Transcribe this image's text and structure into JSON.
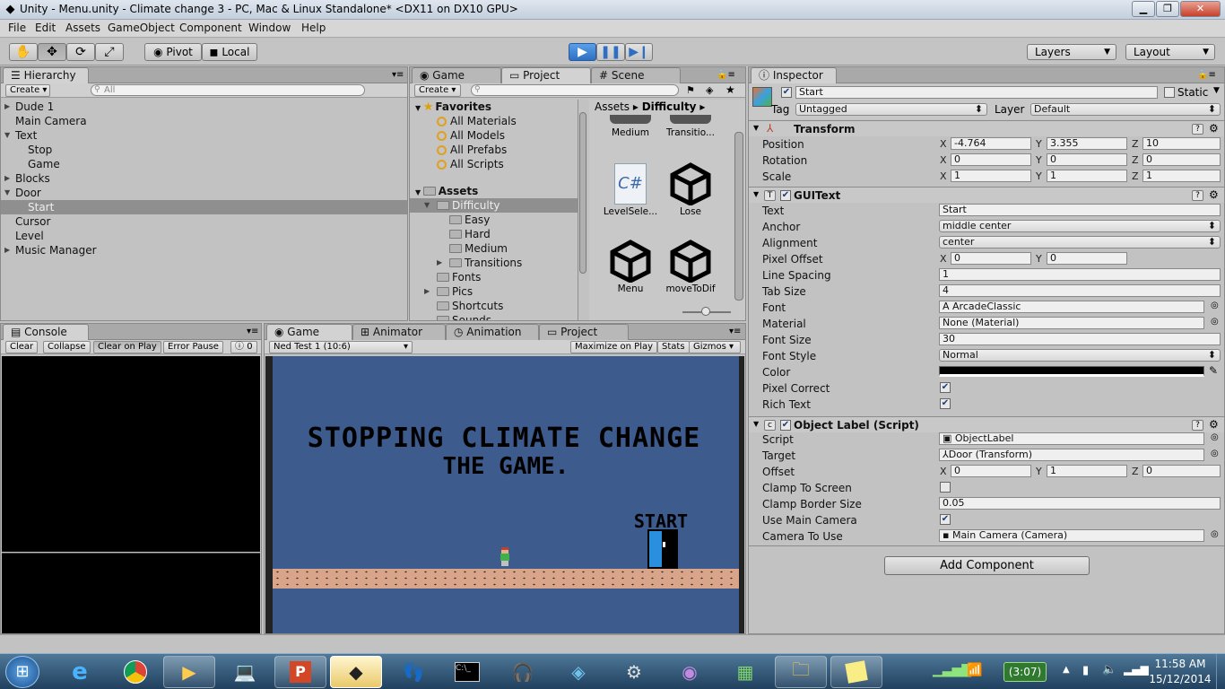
{
  "window": {
    "title": "Unity - Menu.unity - Climate change 3 - PC, Mac & Linux Standalone* <DX11 on DX10 GPU>",
    "minimize": "▁",
    "maximize": "❐",
    "close": "✕"
  },
  "menu": [
    "File",
    "Edit",
    "Assets",
    "GameObject",
    "Component",
    "Window",
    "Help"
  ],
  "toolbar": {
    "pivot_label": "Pivot",
    "local_label": "Local",
    "layers_label": "Layers",
    "layout_label": "Layout"
  },
  "hierarchy": {
    "tab": "Hierarchy",
    "create": "Create",
    "search_placeholder": "All",
    "items": [
      {
        "label": "Dude 1",
        "indent": 0,
        "arrow": "▶"
      },
      {
        "label": "Main Camera",
        "indent": 0,
        "arrow": ""
      },
      {
        "label": "Text",
        "indent": 0,
        "arrow": "▼"
      },
      {
        "label": "Stop",
        "indent": 1,
        "arrow": ""
      },
      {
        "label": "Game",
        "indent": 1,
        "arrow": ""
      },
      {
        "label": "Blocks",
        "indent": 0,
        "arrow": "▶"
      },
      {
        "label": "Door",
        "indent": 0,
        "arrow": "▼"
      },
      {
        "label": "Start",
        "indent": 1,
        "arrow": "",
        "selected": true
      },
      {
        "label": "Cursor",
        "indent": 0,
        "arrow": ""
      },
      {
        "label": "Level",
        "indent": 0,
        "arrow": ""
      },
      {
        "label": "Music Manager",
        "indent": 0,
        "arrow": "▶"
      }
    ]
  },
  "project": {
    "tabs": [
      "Game",
      "Project",
      "Scene"
    ],
    "create": "Create",
    "favorites_label": "Favorites",
    "favorites": [
      "All Materials",
      "All Models",
      "All Prefabs",
      "All Scripts"
    ],
    "assets_label": "Assets",
    "tree": [
      {
        "label": "Difficulty",
        "level": 1,
        "arrow": "▼",
        "selected": true
      },
      {
        "label": "Easy",
        "level": 2,
        "arrow": ""
      },
      {
        "label": "Hard",
        "level": 2,
        "arrow": ""
      },
      {
        "label": "Medium",
        "level": 2,
        "arrow": ""
      },
      {
        "label": "Transitions",
        "level": 2,
        "arrow": "▶"
      },
      {
        "label": "Fonts",
        "level": 1,
        "arrow": ""
      },
      {
        "label": "Pics",
        "level": 1,
        "arrow": "▶"
      },
      {
        "label": "Shortcuts",
        "level": 1,
        "arrow": ""
      },
      {
        "label": "Sounds",
        "level": 1,
        "arrow": ""
      }
    ],
    "breadcrumb": [
      "Assets",
      "Difficulty"
    ],
    "grid": [
      {
        "label": "Medium",
        "kind": "folder-partial"
      },
      {
        "label": "Transitio...",
        "kind": "folder-partial"
      },
      {
        "label": "LevelSele...",
        "kind": "cs"
      },
      {
        "label": "Lose",
        "kind": "unity"
      },
      {
        "label": "Menu",
        "kind": "unity"
      },
      {
        "label": "moveToDif",
        "kind": "unity"
      }
    ]
  },
  "console": {
    "tab": "Console",
    "buttons": [
      "Clear",
      "Collapse",
      "Clear on Play",
      "Error Pause"
    ],
    "count": "0"
  },
  "game": {
    "tabs": [
      "Game",
      "Animator",
      "Animation",
      "Project"
    ],
    "aspect": "Ned Test 1 (10:6)",
    "buttons": [
      "Maximize on Play",
      "Stats",
      "Gizmos"
    ],
    "title_line1": "STOPPING CLIMATE CHANGE",
    "title_line2": "THE GAME.",
    "start_label": "START"
  },
  "inspector": {
    "tab": "Inspector",
    "object_name": "Start",
    "static_label": "Static",
    "tag_label": "Tag",
    "tag_value": "Untagged",
    "layer_label": "Layer",
    "layer_value": "Default",
    "transform": {
      "title": "Transform",
      "rows": [
        {
          "label": "Position",
          "x": "-4.764",
          "y": "3.355",
          "z": "10"
        },
        {
          "label": "Rotation",
          "x": "0",
          "y": "0",
          "z": "0"
        },
        {
          "label": "Scale",
          "x": "1",
          "y": "1",
          "z": "1"
        }
      ]
    },
    "guitext": {
      "title": "GUIText",
      "text_label": "Text",
      "text_value": "Start",
      "anchor_label": "Anchor",
      "anchor_value": "middle center",
      "alignment_label": "Alignment",
      "alignment_value": "center",
      "pixel_offset_label": "Pixel Offset",
      "pixel_offset_x": "0",
      "pixel_offset_y": "0",
      "line_spacing_label": "Line Spacing",
      "line_spacing_value": "1",
      "tab_size_label": "Tab Size",
      "tab_size_value": "4",
      "font_label": "Font",
      "font_value": "ArcadeClassic",
      "material_label": "Material",
      "material_value": "None (Material)",
      "font_size_label": "Font Size",
      "font_size_value": "30",
      "font_style_label": "Font Style",
      "font_style_value": "Normal",
      "color_label": "Color",
      "color_value": "#000000",
      "pixel_correct_label": "Pixel Correct",
      "pixel_correct": true,
      "rich_text_label": "Rich Text",
      "rich_text": true
    },
    "object_label": {
      "title": "Object Label (Script)",
      "script_label": "Script",
      "script_value": "ObjectLabel",
      "target_label": "Target",
      "target_value": "Door (Transform)",
      "offset_label": "Offset",
      "offset_x": "0",
      "offset_y": "1",
      "offset_z": "0",
      "clamp_label": "Clamp To Screen",
      "clamp": false,
      "clamp_border_label": "Clamp Border Size",
      "clamp_border_value": "0.05",
      "use_main_label": "Use Main Camera",
      "use_main": true,
      "camera_label": "Camera To Use",
      "camera_value": "Main Camera (Camera)"
    },
    "add_component": "Add Component"
  },
  "taskbar": {
    "clock_time": "11:58 AM",
    "clock_date": "15/12/2014",
    "battery": "(3:07)"
  },
  "colors": {
    "game_bg": "#3d5b8c",
    "ground": "#d8a48a",
    "door": "#2b8fe0",
    "accent_play": "#2d6fc2"
  }
}
